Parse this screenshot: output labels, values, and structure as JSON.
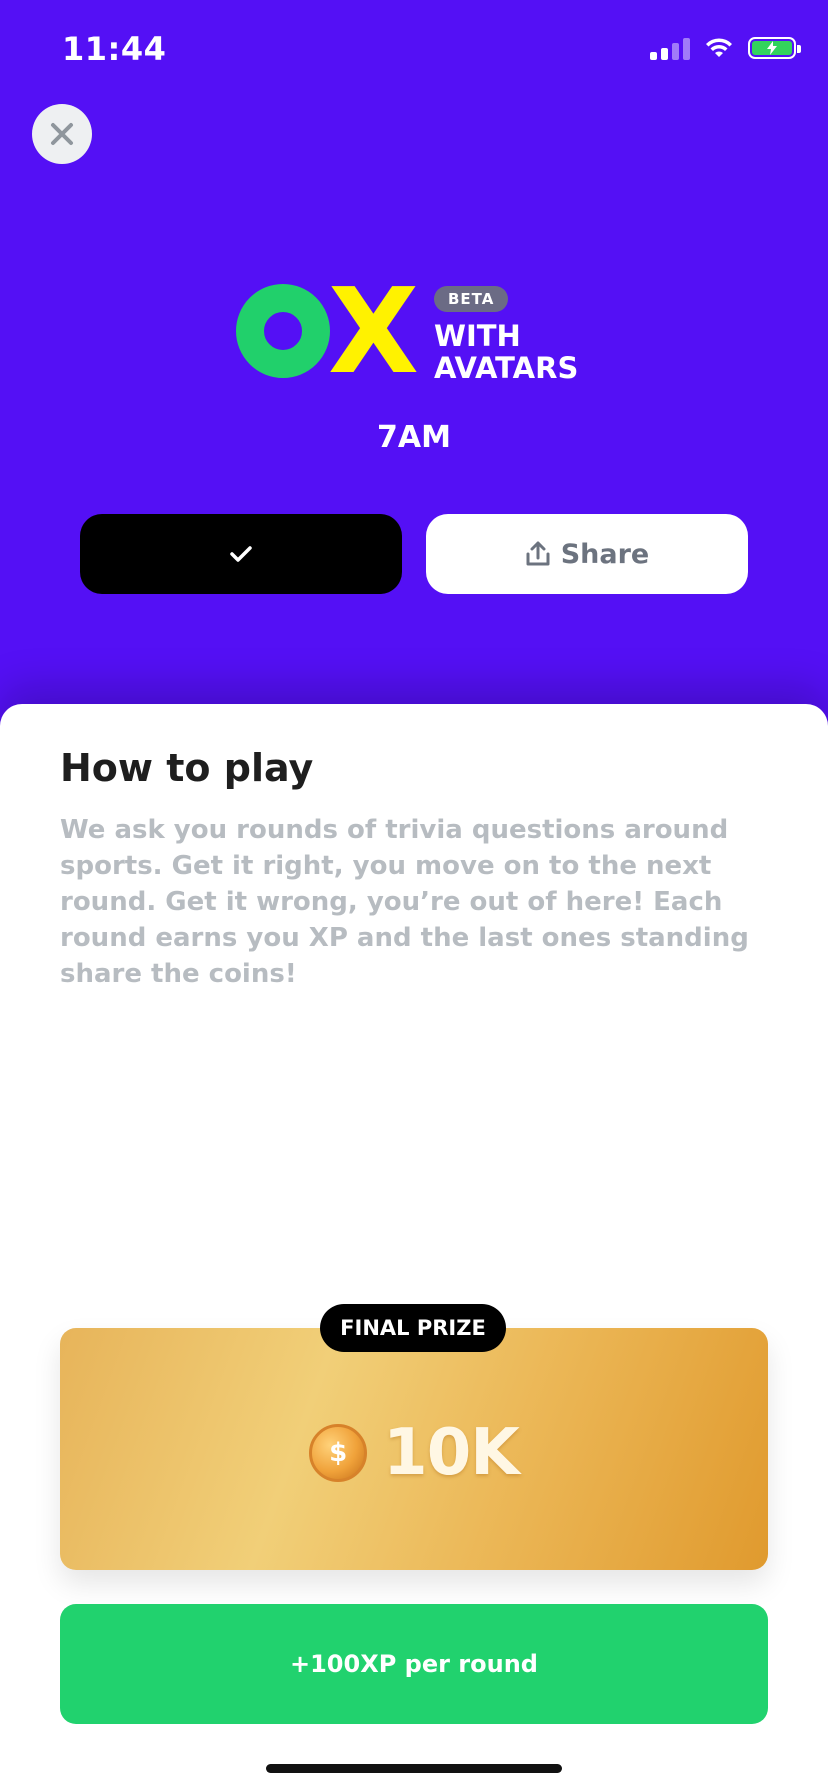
{
  "status_bar": {
    "time": "11:44"
  },
  "close_icon": "close-x",
  "logo": {
    "letter_o": "O",
    "letter_x": "X",
    "badge": "BETA",
    "subtitle": "WITH\nAVATARS",
    "colors": {
      "o": "#21d06b",
      "x": "#fff200"
    }
  },
  "schedule_time": "7AM",
  "actions": {
    "check_icon": "checkmark",
    "share_label": "Share",
    "share_icon": "share-upload"
  },
  "how_to_play": {
    "title": "How to play",
    "body": "We ask you rounds of trivia questions around sports. Get it right, you move on to the next round. Get it wrong, you’re out of here! Each round earns you XP and the last ones standing share the coins!"
  },
  "prize": {
    "badge": "FINAL PRIZE",
    "coin_symbol": "$",
    "amount": "10K"
  },
  "xp_reward": "+100XP per round",
  "colors": {
    "background": "#5410f5",
    "xp_green": "#21d26e",
    "prize_gold": "#f1cf78"
  }
}
